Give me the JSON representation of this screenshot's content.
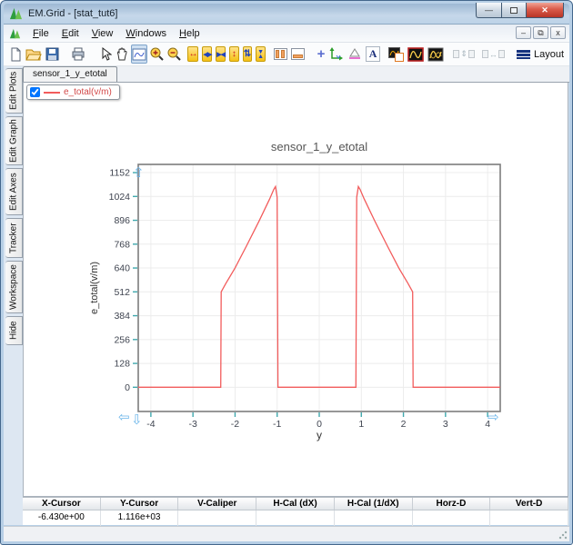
{
  "window": {
    "title": "EM.Grid - [stat_tut6]"
  },
  "menu": {
    "items": [
      "File",
      "Edit",
      "View",
      "Windows",
      "Help"
    ]
  },
  "icons": {
    "minimize_glyph": "—",
    "maximize_glyph": "box",
    "close_glyph": "✕",
    "mdi_minimize_glyph": "–",
    "mdi_restore_glyph": "⧉",
    "mdi_close_glyph": "x",
    "x_expand_glyph": "↔",
    "x_pan_glyph": "◀▶",
    "x_compress_glyph": "▶◀",
    "y_expand_glyph": "↕",
    "y_pan_glyph": "⇅",
    "y_compress_top": "▼",
    "y_compress_bottom": "▲",
    "crosshair_glyph": "+",
    "disabled_v_glyph": "⇕",
    "disabled_h_glyph": "↔"
  },
  "toolbar": {
    "text_tool_label": "A",
    "layout_label": "Layout"
  },
  "tabs": {
    "active": "sensor_1_y_etotal"
  },
  "sidebar": {
    "items": [
      "Edit Plots",
      "Edit Graph",
      "Edit Axes",
      "Tracker",
      "Workspace",
      "Hide"
    ]
  },
  "legend": {
    "checked": true,
    "label": "e_total(v/m)"
  },
  "chart_data": {
    "type": "line",
    "title": "sensor_1_y_etotal",
    "xlabel": "y",
    "ylabel": "e_total(v/m)",
    "xlim": [
      -4.3,
      4.3
    ],
    "ylim": [
      -130,
      1196
    ],
    "x_ticks": [
      -4,
      -3,
      -2,
      -1,
      0,
      1,
      2,
      3,
      4
    ],
    "y_ticks": [
      0,
      128,
      256,
      384,
      512,
      640,
      768,
      896,
      1024,
      1152
    ],
    "grid": true,
    "legend_position": "top-left-panel",
    "series": [
      {
        "name": "e_total(v/m)",
        "color": "#f25c5c",
        "points": [
          [
            -4.3,
            0
          ],
          [
            -2.34,
            0
          ],
          [
            -2.33,
            512
          ],
          [
            -2.22,
            557
          ],
          [
            -2.0,
            640
          ],
          [
            -1.72,
            762
          ],
          [
            -1.43,
            892
          ],
          [
            -1.18,
            1010
          ],
          [
            -1.08,
            1062
          ],
          [
            -1.04,
            1077
          ],
          [
            -1.0,
            1020
          ],
          [
            -0.98,
            0
          ],
          [
            0.87,
            0
          ],
          [
            0.89,
            1020
          ],
          [
            0.93,
            1077
          ],
          [
            0.97,
            1062
          ],
          [
            1.07,
            1010
          ],
          [
            1.32,
            892
          ],
          [
            1.61,
            762
          ],
          [
            1.89,
            640
          ],
          [
            2.11,
            557
          ],
          [
            2.22,
            512
          ],
          [
            2.23,
            0
          ],
          [
            4.3,
            0
          ]
        ]
      }
    ],
    "style": {
      "frame_color": "#7d7d7d",
      "grid_color": "#ececec",
      "tick_color": "#3fa8ad",
      "tick_label_color": "#3f4450",
      "title_color": "#555555",
      "pan_arrow_color": "#6cb6ea"
    }
  },
  "status_table": {
    "columns": [
      "X-Cursor",
      "Y-Cursor",
      "V-Caliper",
      "H-Cal (dX)",
      "H-Cal (1/dX)",
      "Horz-D",
      "Vert-D"
    ],
    "values": [
      "-6.430e+00",
      "1.116e+03",
      "",
      "",
      "",
      "",
      ""
    ]
  }
}
